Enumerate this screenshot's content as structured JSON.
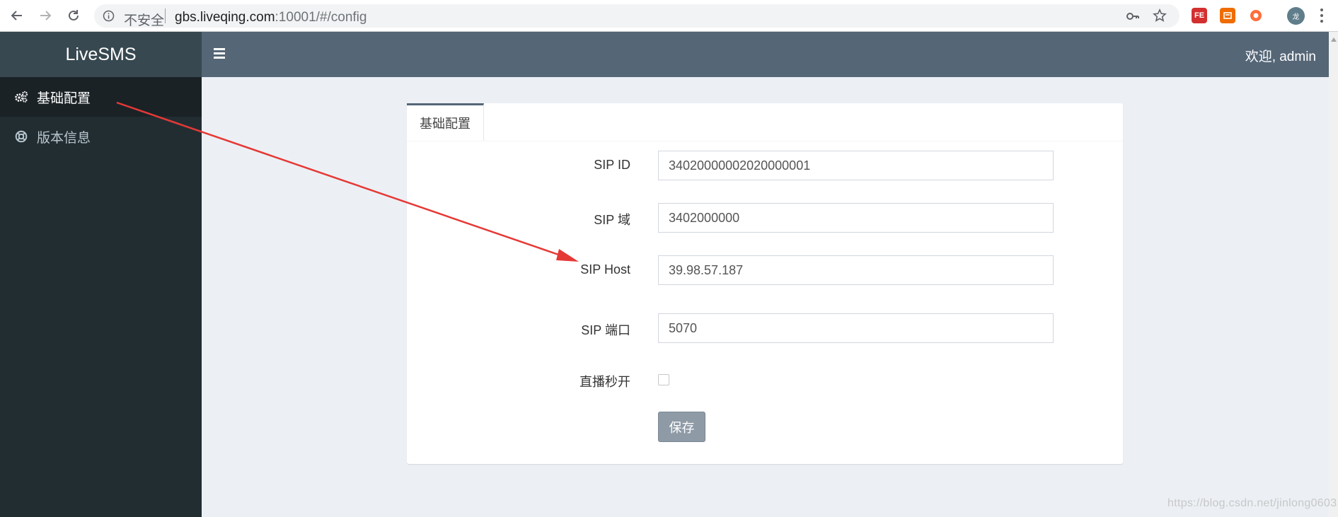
{
  "browser": {
    "insecure_label": "不安全",
    "url_host": "gbs.liveqing.com",
    "url_rest": ":10001/#/config",
    "extensions": [
      "FE",
      "",
      ""
    ],
    "avatar_text": "龙"
  },
  "app": {
    "brand": "LiveSMS",
    "welcome": "欢迎, admin"
  },
  "sidebar": {
    "items": [
      {
        "label": "基础配置",
        "icon": "gears-icon",
        "active": true
      },
      {
        "label": "版本信息",
        "icon": "life-ring-icon",
        "active": false
      }
    ]
  },
  "panel": {
    "tab_label": "基础配置",
    "fields": [
      {
        "label": "SIP ID",
        "value": "34020000002020000001"
      },
      {
        "label": "SIP 域",
        "value": "3402000000"
      },
      {
        "label": "SIP Host",
        "value": "39.98.57.187"
      },
      {
        "label": "SIP 端口",
        "value": "5070"
      }
    ],
    "live_fast_label": "直播秒开",
    "live_fast_checked": false,
    "save_label": "保存"
  },
  "colors": {
    "sidebar_bg": "#222d32",
    "topbar_bg": "#556677",
    "content_bg": "#ecf0f5",
    "annotation_arrow": "#e53935"
  },
  "watermark": "https://blog.csdn.net/jinlong0603"
}
